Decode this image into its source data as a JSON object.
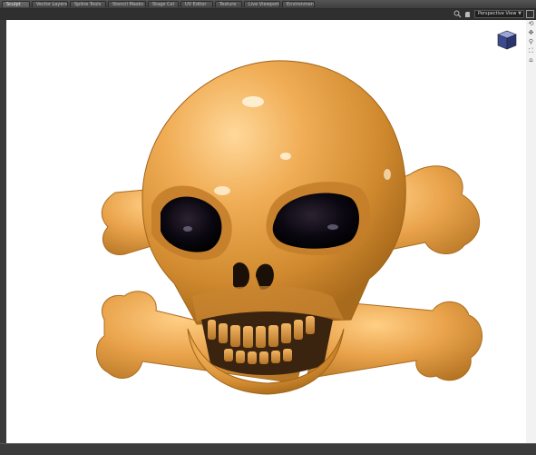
{
  "tabs": [
    {
      "label": "Sculpt"
    },
    {
      "label": "Vector Layers"
    },
    {
      "label": "Spline Tools"
    },
    {
      "label": "Stencil Masks"
    },
    {
      "label": "Stage Cel"
    },
    {
      "label": "UV Editor"
    },
    {
      "label": "Texture"
    },
    {
      "label": "Live Viewport"
    },
    {
      "label": "Environment"
    }
  ],
  "viewport": {
    "view_mode": "Perspective View",
    "object": "skull-and-crossbones"
  },
  "icons": {
    "header": [
      "search-icon",
      "pan-icon"
    ],
    "nav": [
      "rotate-icon",
      "pan-icon",
      "zoom-icon",
      "fit-icon",
      "reset-icon"
    ]
  },
  "colors": {
    "model": "#e3a24a",
    "viewport_bg": "#ffffff"
  }
}
